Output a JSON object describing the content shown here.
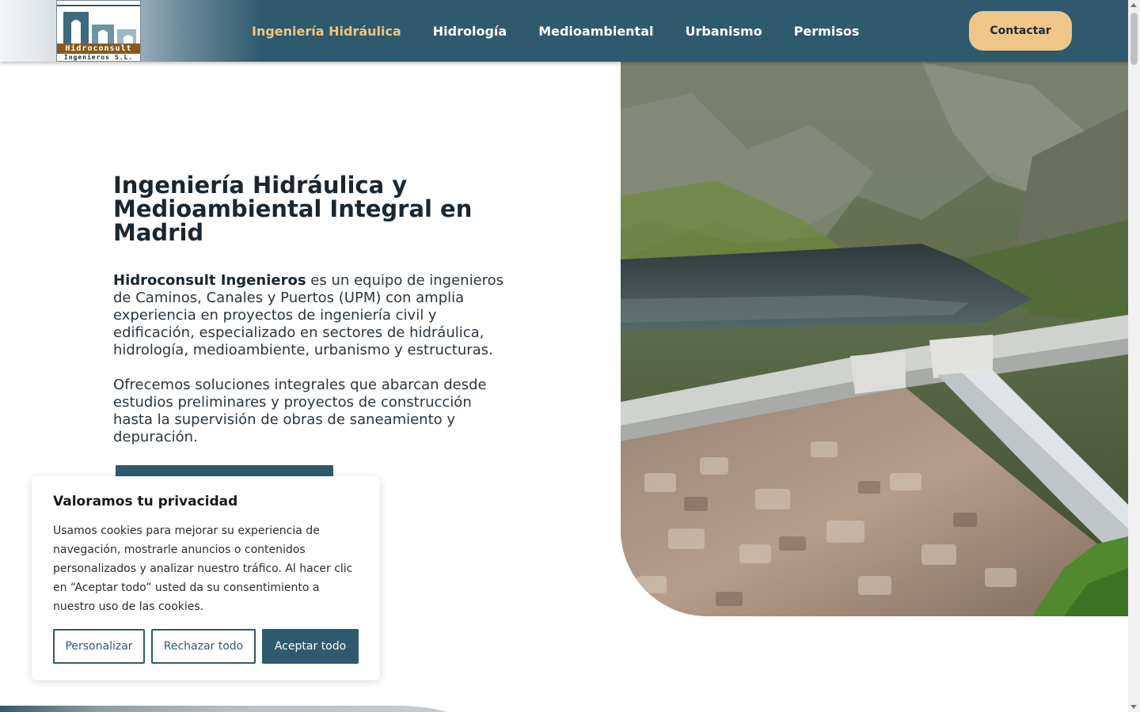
{
  "brand": {
    "logo_name": "Hidroconsult",
    "logo_sub": "Ingenieros S.L."
  },
  "nav": {
    "items": [
      {
        "label": "Ingeniería Hidráulica",
        "active": true
      },
      {
        "label": "Hidrología",
        "active": false
      },
      {
        "label": "Medioambiental",
        "active": false
      },
      {
        "label": "Urbanismo",
        "active": false
      },
      {
        "label": "Permisos",
        "active": false
      }
    ],
    "contact_label": "Contactar"
  },
  "hero": {
    "title": "Ingeniería Hidráulica y Medioambiental Integral en Madrid",
    "p1_strong": "Hidroconsult Ingenieros",
    "p1_rest": " es un equipo de ingenieros de Caminos, Canales y Puertos (UPM) con amplia experiencia en proyectos de ingeniería civil y edificación, especializado en sectores de hidráulica, hidrología, medioambiente, urbanismo y estructuras.",
    "p2": "Ofrecemos soluciones integrales que abarcan desde estudios preliminares y proyectos de construcción hasta la supervisión de obras de saneamiento y depuración.",
    "image": "dam-reservoir-mountain-photo"
  },
  "cookie": {
    "title": "Valoramos tu privacidad",
    "text": "Usamos cookies para mejorar su experiencia de navegación, mostrarle anuncios o contenidos personalizados y analizar nuestro tráfico. Al hacer clic en “Aceptar todo” usted da su consentimiento a nuestro uso de las cookies.",
    "customize": "Personalizar",
    "reject": "Rechazar todo",
    "accept": "Aceptar todo"
  },
  "colors": {
    "header": "#2f5a6d",
    "accent": "#efc688",
    "active_nav": "#eec585"
  }
}
